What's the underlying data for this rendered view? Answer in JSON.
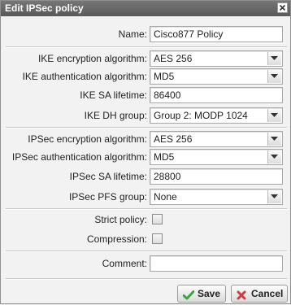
{
  "dialog": {
    "title": "Edit IPSec policy"
  },
  "fields": {
    "name": {
      "label": "Name:",
      "value": "Cisco877 Policy"
    },
    "ike_enc": {
      "label": "IKE encryption algorithm:",
      "value": "AES 256"
    },
    "ike_auth": {
      "label": "IKE authentication algorithm:",
      "value": "MD5"
    },
    "ike_lifetime": {
      "label": "IKE SA lifetime:",
      "value": "86400"
    },
    "ike_dh": {
      "label": "IKE DH group:",
      "value": "Group 2: MODP 1024"
    },
    "ipsec_enc": {
      "label": "IPSec encryption algorithm:",
      "value": "AES 256"
    },
    "ipsec_auth": {
      "label": "IPSec authentication algorithm:",
      "value": "MD5"
    },
    "ipsec_lifetime": {
      "label": "IPSec SA lifetime:",
      "value": "28800"
    },
    "ipsec_pfs": {
      "label": "IPSec PFS group:",
      "value": "None"
    },
    "strict": {
      "label": "Strict policy:",
      "checked": false
    },
    "compression": {
      "label": "Compression:",
      "checked": false
    },
    "comment": {
      "label": "Comment:",
      "value": ""
    }
  },
  "buttons": {
    "save": "Save",
    "cancel": "Cancel"
  },
  "colors": {
    "titlebar": "#6a6a6a",
    "save_icon": "#3aa63a",
    "cancel_icon": "#d23b3b"
  }
}
